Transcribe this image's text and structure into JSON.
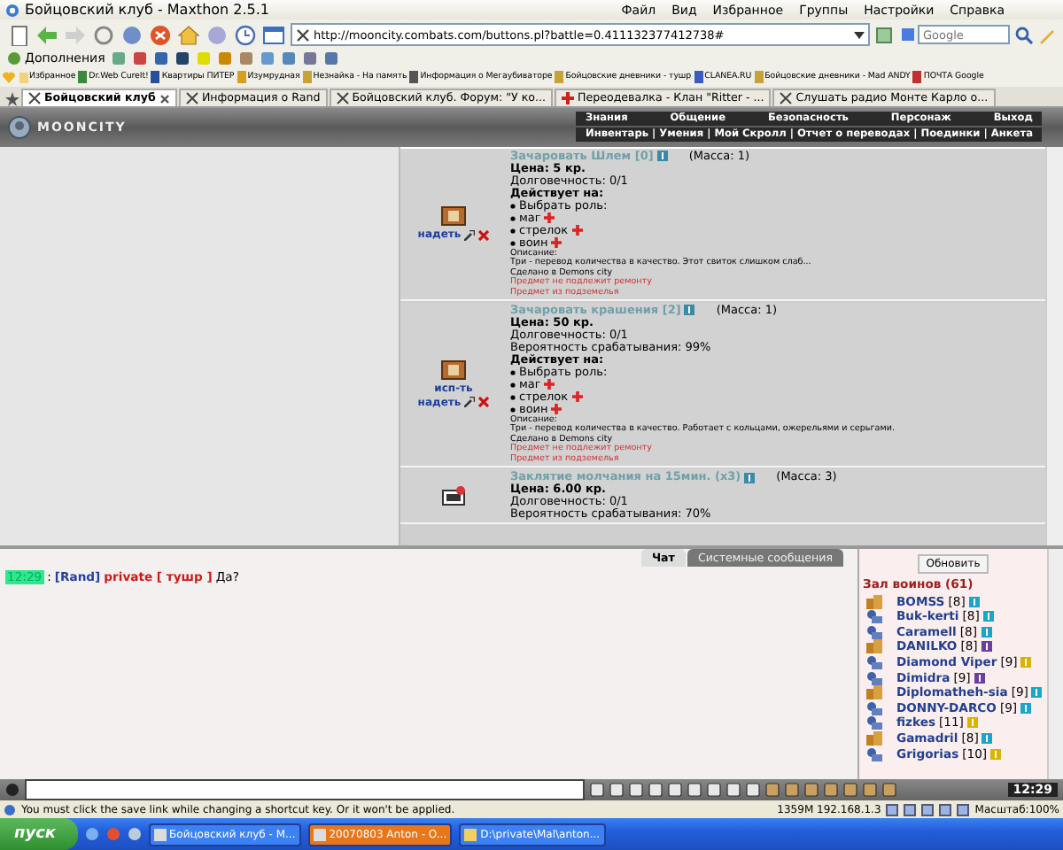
{
  "window": {
    "title": "Бойцовский клуб - Maxthon 2.5.1",
    "menu": [
      "Файл",
      "Вид",
      "Избранное",
      "Группы",
      "Настройки",
      "Справка"
    ]
  },
  "toolbar": {
    "address": "http://mooncity.combats.com/buttons.pl?battle=0.411132377412738#",
    "search_placeholder": "Google"
  },
  "addons": {
    "label": "Дополнения"
  },
  "favorites": [
    "Избранное",
    "Dr.Web CureIt!",
    "Квартиры ПИТЕР",
    "Изумрудная",
    "Незнайка - На память",
    "Информация о Мегаубиваторе",
    "Бойцовские дневники - тушр",
    "CLANEA.RU",
    "Бойцовские дневники - Mad ANDY",
    "ПОЧТА Google"
  ],
  "tabs": [
    {
      "label": "Бойцовский клуб",
      "selected": true
    },
    {
      "label": "Информация о Rand",
      "selected": false
    },
    {
      "label": "Бойцовский клуб. Форум: \"У ко...",
      "selected": false
    },
    {
      "label": "Переодевалка - Клан \"Ritter - ...",
      "selected": false
    },
    {
      "label": "Слушать радио Монте Карло о...",
      "selected": false
    }
  ],
  "game": {
    "logo": "MOONCITY",
    "menu_top": [
      "Знания",
      "Общение",
      "Безопасность",
      "Персонаж",
      "Выход"
    ],
    "menu_bottom": [
      "Инвентарь",
      "Умения",
      "Мой Скролл",
      "Отчет о переводах",
      "Поединки",
      "Анкета"
    ],
    "separator": "|"
  },
  "items": [
    {
      "title": "Зачаровать Шлем [0]",
      "mass": "(Масса: 1)",
      "actions": [
        "надеть"
      ],
      "lines": [
        {
          "kind": "price",
          "text": "Цена: 5 кр."
        },
        {
          "kind": "plain",
          "text": "Долговечность: 0/1"
        },
        {
          "kind": "heading",
          "text": "Действует на:"
        },
        {
          "kind": "bullet",
          "text": "Выбрать роль:"
        },
        {
          "kind": "role",
          "text": "маг"
        },
        {
          "kind": "role",
          "text": "стрелок"
        },
        {
          "kind": "role",
          "text": "воин"
        },
        {
          "kind": "small",
          "text": "Описание:"
        },
        {
          "kind": "small",
          "text": "Три - перевод количества в качество. Этот свиток слишком слаб..."
        },
        {
          "kind": "small",
          "text": "Сделано в Demons city"
        },
        {
          "kind": "warn",
          "text": "Предмет не подлежит ремонту"
        },
        {
          "kind": "warn",
          "text": "Предмет из подземелья"
        }
      ]
    },
    {
      "title": "Зачаровать крашения [2]",
      "mass": "(Масса: 1)",
      "actions": [
        "исп-ть",
        "надеть"
      ],
      "lines": [
        {
          "kind": "price",
          "text": "Цена: 50 кр."
        },
        {
          "kind": "plain",
          "text": "Долговечность: 0/1"
        },
        {
          "kind": "plain",
          "text": "Вероятность срабатывания: 99%"
        },
        {
          "kind": "heading",
          "text": "Действует на:"
        },
        {
          "kind": "bullet",
          "text": "Выбрать роль:"
        },
        {
          "kind": "role",
          "text": "маг"
        },
        {
          "kind": "role",
          "text": "стрелок"
        },
        {
          "kind": "role",
          "text": "воин"
        },
        {
          "kind": "small",
          "text": "Описание:"
        },
        {
          "kind": "small",
          "text": "Три - перевод количества в качество. Работает с кольцами, ожерельями и серьгами."
        },
        {
          "kind": "small",
          "text": "Сделано в Demons city"
        },
        {
          "kind": "warn",
          "text": "Предмет не подлежит ремонту"
        },
        {
          "kind": "warn",
          "text": "Предмет из подземелья"
        }
      ]
    },
    {
      "title": "Заклятие молчания на 15мин. (x3)",
      "mass": "(Масса: 3)",
      "lines": [
        {
          "kind": "price",
          "text": "Цена: 6.00 кр."
        },
        {
          "kind": "plain",
          "text": "Долговечность: 0/1"
        },
        {
          "kind": "plain",
          "text": "Вероятность срабатывания: 70%"
        }
      ]
    }
  ],
  "chat_tabs": [
    {
      "label": "Чат",
      "selected": true
    },
    {
      "label": "Системные сообщения",
      "selected": false
    }
  ],
  "chat": [
    {
      "time": "12:29",
      "separator": ":",
      "sender": "[Rand]",
      "channel": "private [ тушр ]",
      "text": "Да?"
    }
  ],
  "players": {
    "refresh": "Обновить",
    "room": "Зал воинов (61)",
    "list": [
      {
        "name": "BOMSS",
        "rank": "[8]",
        "color": "#1aa6c8"
      },
      {
        "name": "Buk-kerti",
        "rank": "[8]",
        "color": "#1aa6c8"
      },
      {
        "name": "Caramell",
        "rank": "[8]",
        "color": "#1aa6c8"
      },
      {
        "name": "DANILKO",
        "rank": "[8]",
        "color": "#6a3fa0"
      },
      {
        "name": "Diamond Viper",
        "rank": "[9]",
        "color": "#d8b400"
      },
      {
        "name": "Dimidra",
        "rank": "[9]",
        "color": "#6a3fa0"
      },
      {
        "name": "Diplomatheh-sia",
        "rank": "[9]",
        "color": "#1aa6c8"
      },
      {
        "name": "DONNY-DARCO",
        "rank": "[9]",
        "color": "#1aa6c8"
      },
      {
        "name": "fizkes",
        "rank": "[11]",
        "color": "#d8b400"
      },
      {
        "name": "Gamadril",
        "rank": "[8]",
        "color": "#1aa6c8"
      },
      {
        "name": "Grigorias",
        "rank": "[10]",
        "color": "#d8b400"
      }
    ]
  },
  "chat_bar": {
    "clock": "12:29"
  },
  "status_bar": {
    "message": "You must click the save link while changing a shortcut key. Or it won't be applied.",
    "memory": "1359M 192.168.1.3",
    "zoom": "Масштаб:100%"
  },
  "taskbar": {
    "start": "пуск",
    "tasks": [
      "Бойцовский клуб - M...",
      "20070803 Anton - O...",
      "D:\\private\\Mal\\anton..."
    ]
  }
}
